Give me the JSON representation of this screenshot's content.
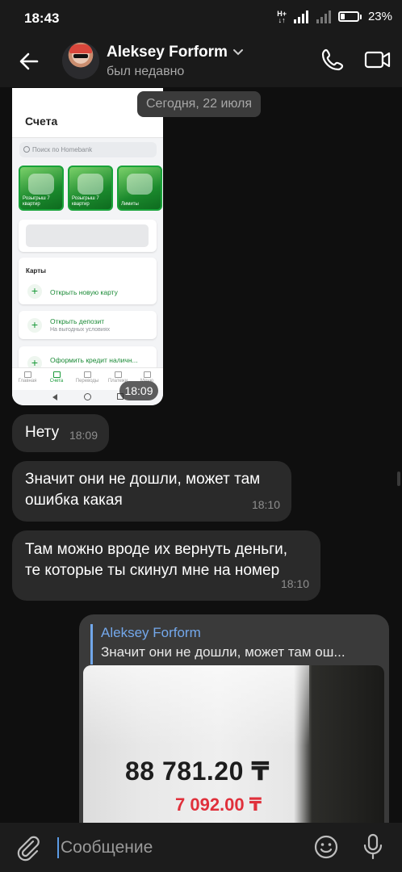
{
  "status_bar": {
    "time": "18:43",
    "network_top": "H+",
    "network_bottom": "↓↑",
    "battery": "23%",
    "battery_level_percent": 23
  },
  "header": {
    "name": "Aleksey Forform",
    "status": "был недавно",
    "icons": [
      "back-arrow-icon",
      "chevron-down-icon",
      "phone-icon",
      "video-icon"
    ]
  },
  "date_pill": "Сегодня, 22 июля",
  "screenshot_message": {
    "time": "18:09",
    "app": {
      "title": "Счета",
      "search_placeholder": "Поиск по Homebank",
      "promos": [
        {
          "label": "Розыгрыш 7 квартир"
        },
        {
          "label": "Розыгрыш 7 квартир"
        },
        {
          "label": "Лимиты"
        }
      ],
      "cards_header": "Карты",
      "open_card": "Открыть новую карту",
      "open_deposit": "Открыть депозит",
      "deposit_sub": "На выгодных условиях",
      "credit": "Оформить кредит наличн...",
      "tabs": [
        "Главная",
        "Счета",
        "Переводы",
        "Платежи",
        "Меню"
      ],
      "accent": "#1a9a3a"
    }
  },
  "messages": [
    {
      "text": "Нету",
      "time": "18:09"
    },
    {
      "text_line1": "Значит они не дошли, может там",
      "text_line2": "ошибка какая",
      "time": "18:10"
    },
    {
      "text_line1": "Там можно вроде их вернуть деньги,",
      "text_line2": "те которые ты скинул мне на номер",
      "time": "18:10"
    }
  ],
  "reply": {
    "quote_name": "Aleksey Forform",
    "quote_text": "Значит они не дошли, может там ош...",
    "photo_amount_main": "88 781.20 ₸",
    "photo_amount_red": "7 092.00 ₸"
  },
  "input": {
    "placeholder": "Сообщение",
    "icons": [
      "paperclip-icon",
      "emoji-icon",
      "microphone-icon"
    ]
  },
  "colors": {
    "background": "#0f0f0f",
    "bubble_incoming": "#2a2a2a",
    "bubble_outgoing": "#3a3a3a",
    "quote_accent": "#71a7ea",
    "red_amount": "#e0303b"
  }
}
